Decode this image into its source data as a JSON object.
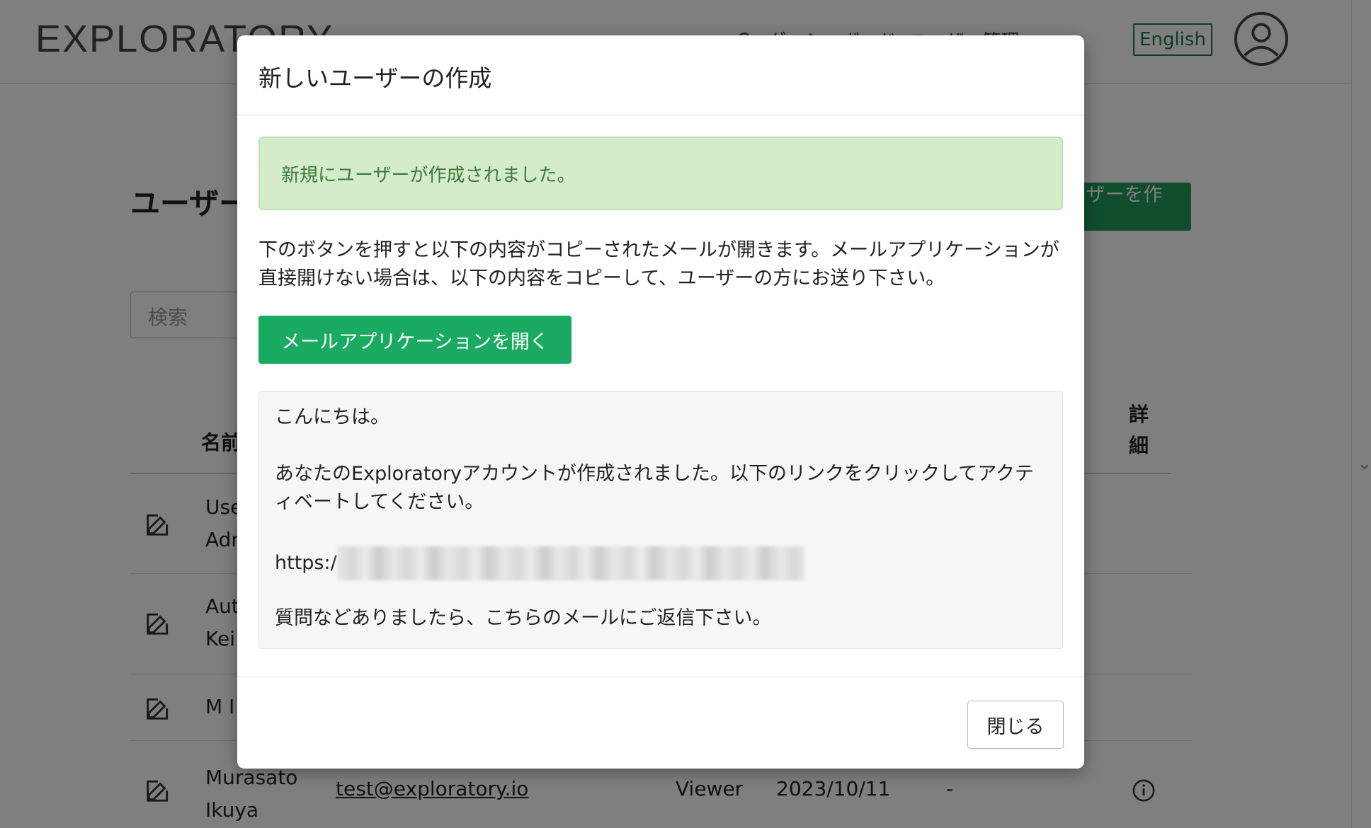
{
  "app": {
    "logo": "EXPLORATORY",
    "nav_items": [
      "ダッシュボード",
      "ユーザー管理"
    ],
    "language_button": "English"
  },
  "page": {
    "title": "ユーザー管理",
    "create_button": "ユーザーを作成",
    "search_placeholder": "検索",
    "table_headers": {
      "name": "名前",
      "detail": "詳細"
    },
    "rows": [
      {
        "name_line1": "User",
        "name_line2": "Admin"
      },
      {
        "name_line1": "Author",
        "name_line2": "Kei"
      },
      {
        "name_line1": "M I"
      },
      {
        "name_line1": "Murasato",
        "name_line2": "Ikuya",
        "email": "test@exploratory.io",
        "role": "Viewer",
        "date": "2023/10/11",
        "dash": "-"
      }
    ]
  },
  "modal": {
    "title": "新しいユーザーの作成",
    "alert_text": "新規にユーザーが作成されました。",
    "description": "下のボタンを押すと以下の内容がコピーされたメールが開きます。メールアプリケーションが直接開けない場合は、以下の内容をコピーして、ユーザーの方にお送り下さい。",
    "mail_button": "メールアプリケーションを開く",
    "message": {
      "greeting": "こんにちは。",
      "body": "あなたのExploratoryアカウントが作成されました。以下のリンクをクリックしてアクティベートしてください。",
      "link_prefix": "https:/",
      "closing": "質問などありましたら、こちらのメールにご返信下さい。"
    },
    "close_button": "閉じる"
  },
  "colors": {
    "brand_green": "#1e9a5a",
    "button_green": "#1aaa62",
    "alert_bg": "#d5eccb",
    "alert_text": "#3e7a3a"
  }
}
